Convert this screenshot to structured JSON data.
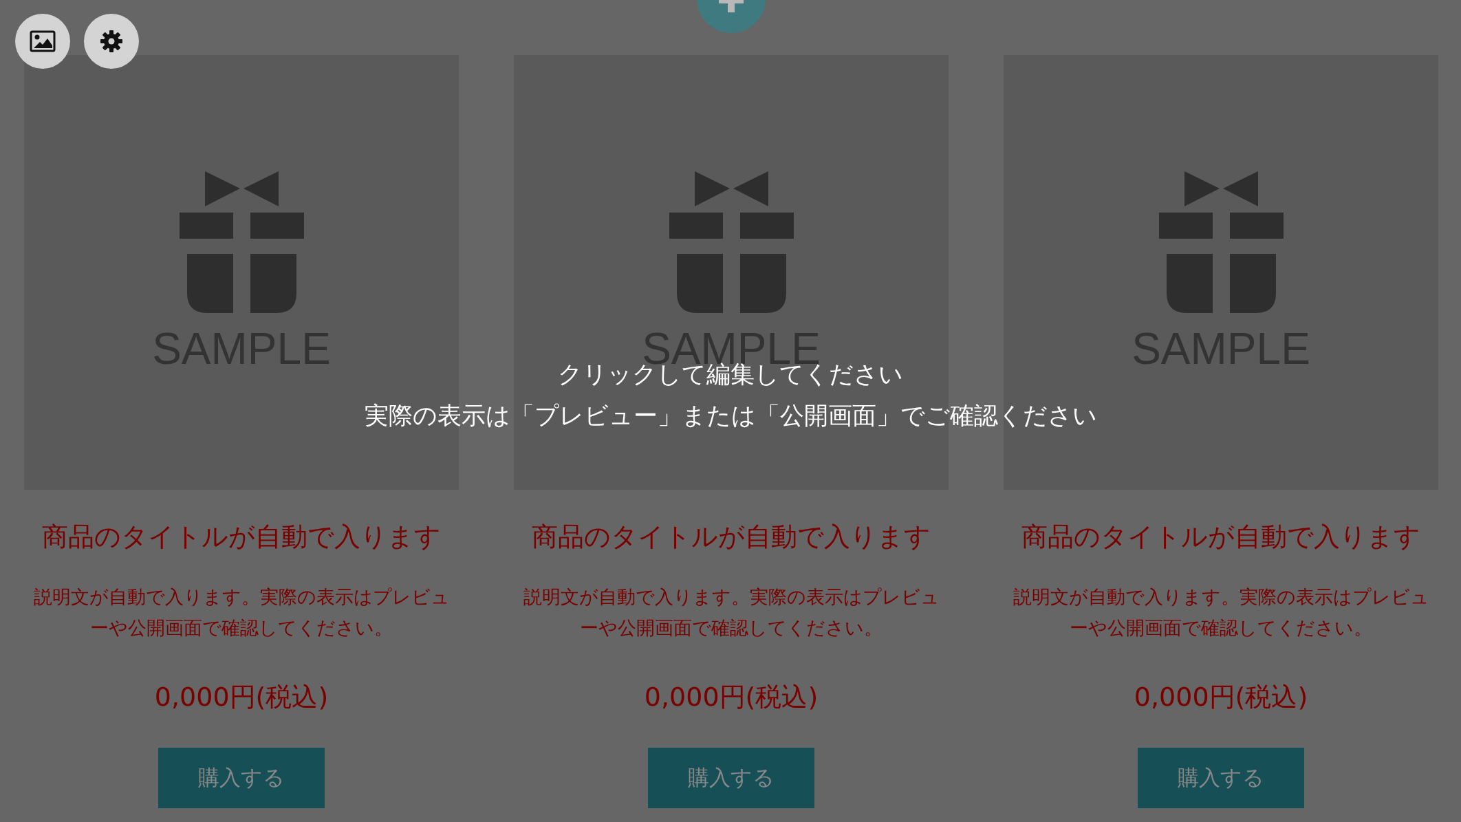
{
  "toolbar": {
    "buttons": [
      {
        "kind": "image"
      },
      {
        "kind": "settings"
      }
    ]
  },
  "add_button": {
    "kind": "plus"
  },
  "products": [
    {
      "image_label": "SAMPLE",
      "title": "商品のタイトルが自動で入ります",
      "description": "説明文が自動で入ります。実際の表示はプレビューや公開画面で確認してください。",
      "price": "0,000円(税込)",
      "button": "購入する"
    },
    {
      "image_label": "SAMPLE",
      "title": "商品のタイトルが自動で入ります",
      "description": "説明文が自動で入ります。実際の表示はプレビューや公開画面で確認してください。",
      "price": "0,000円(税込)",
      "button": "購入する"
    },
    {
      "image_label": "SAMPLE",
      "title": "商品のタイトルが自動で入ります",
      "description": "説明文が自動で入ります。実際の表示はプレビューや公開画面で確認してください。",
      "price": "0,000円(税込)",
      "button": "購入する"
    }
  ],
  "overlay": {
    "lines": [
      "クリックして編集してください",
      "実際の表示は「プレビュー」または「公開画面」でご確認ください"
    ]
  }
}
